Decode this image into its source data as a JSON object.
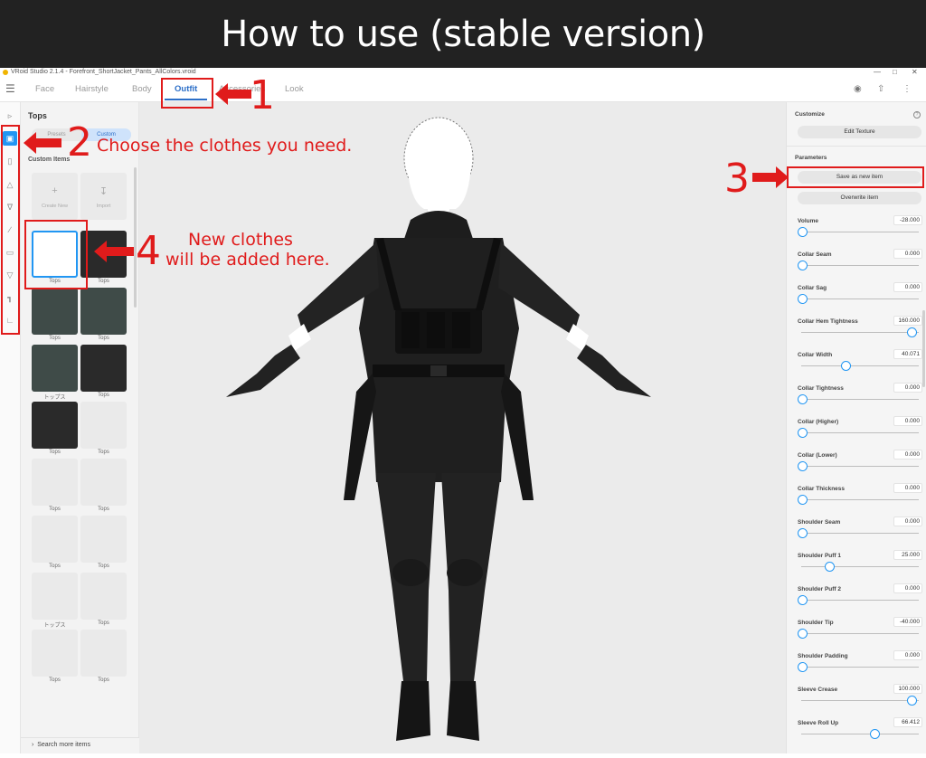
{
  "banner": {
    "title": "How to use (stable version)"
  },
  "window": {
    "title": "VRoid Studio 2.1.4 - Forefront_ShortJacket_Pants_AllColors.vroid"
  },
  "nav": {
    "menu_icon": "hamburger-icon",
    "tabs": [
      "Face",
      "Hairstyle",
      "Body",
      "Outfit",
      "Accessories",
      "Look"
    ],
    "active_tab": "Outfit",
    "right_icons": [
      "camera-icon",
      "share-icon",
      "more-icon"
    ]
  },
  "sidebar": {
    "categories": [
      "hat-icon",
      "tops-icon",
      "jacket-icon",
      "onepiece-icon",
      "bottoms-icon",
      "socks-icon",
      "shoes-icon",
      "gloves-icon",
      "underwear-icon",
      "shoes-icon"
    ],
    "active_index": 1
  },
  "left_panel": {
    "title": "Tops",
    "segment_options": [
      "Presets",
      "Custom"
    ],
    "segment_selected": "Custom",
    "section_label": "Custom Items",
    "create_new_label": "Create New",
    "import_label": "Import",
    "items": [
      {
        "label": "Tops"
      },
      {
        "label": "Tops"
      },
      {
        "label": "Tops"
      },
      {
        "label": "Tops"
      },
      {
        "label": "トップス"
      },
      {
        "label": "Tops"
      },
      {
        "label": "Tops"
      },
      {
        "label": "Tops"
      },
      {
        "label": "Tops"
      },
      {
        "label": "Tops"
      },
      {
        "label": "Tops"
      },
      {
        "label": "Tops"
      },
      {
        "label": "トップス"
      },
      {
        "label": "Tops"
      },
      {
        "label": "Tops"
      },
      {
        "label": "Tops"
      }
    ],
    "search_more": "Search more items"
  },
  "right_panel": {
    "customize_label": "Customize",
    "edit_texture": "Edit Texture",
    "parameters_label": "Parameters",
    "save_new": "Save as new item",
    "overwrite": "Overwrite item",
    "params": [
      {
        "name": "Volume",
        "value": "-28.000",
        "pos": 0.0
      },
      {
        "name": "Collar Seam",
        "value": "0.000",
        "pos": 0.0
      },
      {
        "name": "Collar Sag",
        "value": "0.000",
        "pos": 0.0
      },
      {
        "name": "Collar Hem Tightness",
        "value": "160.000",
        "pos": 1.0
      },
      {
        "name": "Collar Width",
        "value": "40.071",
        "pos": 0.4
      },
      {
        "name": "Collar Tightness",
        "value": "0.000",
        "pos": 0.0
      },
      {
        "name": "Collar (Higher)",
        "value": "0.000",
        "pos": 0.0
      },
      {
        "name": "Collar (Lower)",
        "value": "0.000",
        "pos": 0.0
      },
      {
        "name": "Collar Thickness",
        "value": "0.000",
        "pos": 0.0
      },
      {
        "name": "Shoulder Seam",
        "value": "0.000",
        "pos": 0.0
      },
      {
        "name": "Shoulder Puff 1",
        "value": "25.000",
        "pos": 0.25
      },
      {
        "name": "Shoulder Puff 2",
        "value": "0.000",
        "pos": 0.0
      },
      {
        "name": "Shoulder Tip",
        "value": "-40.000",
        "pos": 0.0
      },
      {
        "name": "Shoulder Padding",
        "value": "0.000",
        "pos": 0.0
      },
      {
        "name": "Sleeve Crease",
        "value": "100.000",
        "pos": 1.0
      },
      {
        "name": "Sleeve Roll Up",
        "value": "66.412",
        "pos": 0.66
      }
    ]
  },
  "annotations": {
    "n1": "1",
    "n2": "2",
    "n2_text": "Choose the clothes you need.",
    "n3": "3",
    "n4": "4",
    "n4_line1": "New clothes",
    "n4_line2": "will be added here.",
    "color": "#e01b1b"
  }
}
